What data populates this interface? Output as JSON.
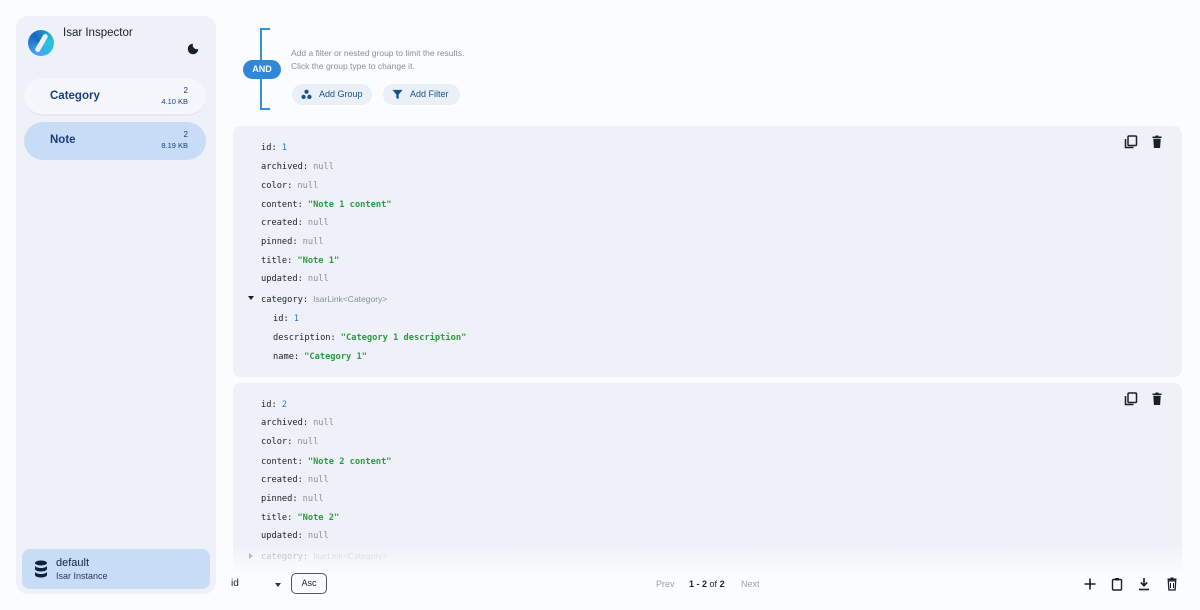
{
  "app": {
    "title": "Isar Inspector"
  },
  "collections": [
    {
      "name": "Category",
      "count": "2",
      "size": "4.10 KB"
    },
    {
      "name": "Note",
      "count": "2",
      "size": "8.19 KB"
    }
  ],
  "instance": {
    "name": "default",
    "subtitle": "Isar Instance"
  },
  "filter": {
    "group_type": "AND",
    "hint_line1": "Add a filter or nested group to limit the results.",
    "hint_line2": "Click the group type to change it.",
    "add_group_label": "Add Group",
    "add_filter_label": "Add Filter"
  },
  "objects": [
    {
      "id": "1",
      "archived": "null",
      "color": "null",
      "content": "\"Note 1 content\"",
      "created": "null",
      "pinned": "null",
      "title": "\"Note 1\"",
      "updated": "null",
      "category": {
        "link_type": "IsarLink<Category>",
        "id": "1",
        "description": "\"Category 1 description\"",
        "name": "\"Category 1\""
      }
    },
    {
      "id": "2",
      "archived": "null",
      "color": "null",
      "content": "\"Note 2 content\"",
      "created": "null",
      "pinned": "null",
      "title": "\"Note 2\"",
      "updated": "null",
      "category": {
        "link_type": "IsarLink<Category>"
      }
    }
  ],
  "footer": {
    "sort_field": "id",
    "sort_order": "Asc",
    "prev_label": "Prev",
    "next_label": "Next",
    "range": "1 - 2",
    "of_label": "of",
    "total": "2"
  },
  "colors": {
    "accent": "#2f87d6",
    "string_value": "#2e9a3e",
    "number_value": "#2b78c4",
    "null_value": "#8a8f9a",
    "selected_bg": "#c9dcf6"
  }
}
